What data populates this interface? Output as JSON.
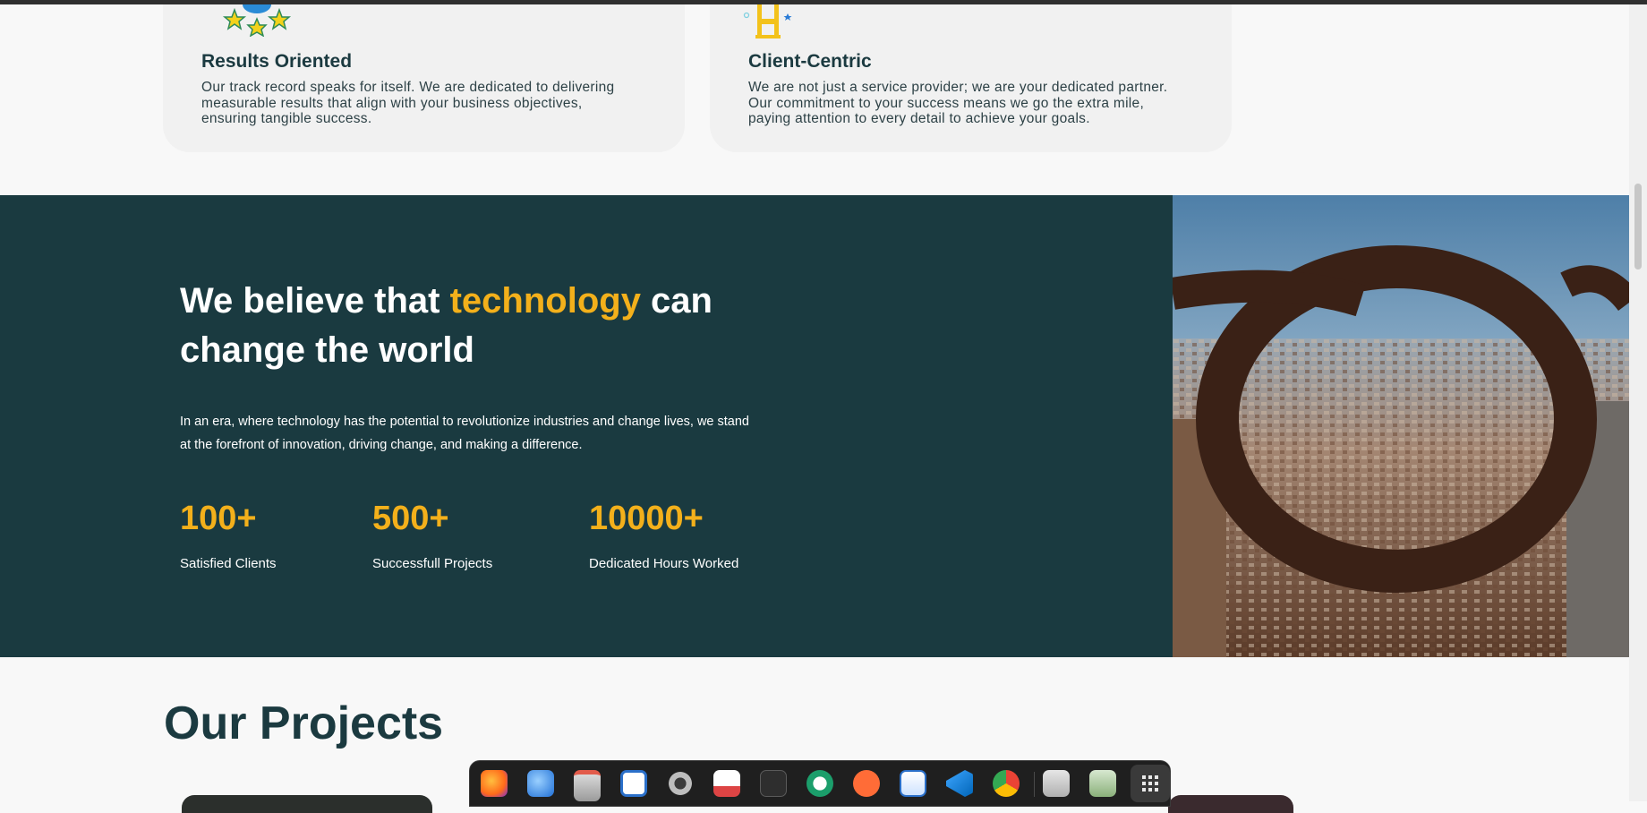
{
  "features": [
    {
      "title": "Results Oriented",
      "icon": "medal-stars-icon",
      "lines": [
        "Our track record speaks for itself. We are dedicated to delivering",
        "measurable results that align with your business objectives,",
        "ensuring tangible success."
      ]
    },
    {
      "title": "Client-Centric",
      "icon": "trophy-icon",
      "lines": [
        "We are not just a service provider; we are your dedicated partner.",
        "Our commitment to your success means we go the extra mile,",
        "paying attention to every detail to achieve your goals."
      ]
    }
  ],
  "hero": {
    "headline_pre": "We believe that ",
    "headline_accent": "technology",
    "headline_post": " can change the world",
    "description": "In an era, where technology has the potential to revolutionize industries and change lives, we stand at the forefront of innovation, driving change, and making a difference.",
    "accent_color": "#f3b01b",
    "background_color": "#1a3a40"
  },
  "stats": [
    {
      "value": "100+",
      "label": "Satisfied Clients"
    },
    {
      "value": "500+",
      "label": "Successfull Projects"
    },
    {
      "value": "10000+",
      "label": "Dedicated Hours Worked"
    }
  ],
  "projects": {
    "title": "Our Projects"
  },
  "dock": {
    "items": [
      "firefox-icon",
      "thunderbird-icon",
      "files-icon",
      "writer-icon",
      "settings-icon",
      "document-viewer-icon",
      "terminal-icon",
      "remote-desktop-icon",
      "postman-icon",
      "text-editor-icon",
      "vscode-icon",
      "chrome-icon",
      "image-viewer-icon",
      "trash-icon",
      "app-grid-icon"
    ]
  }
}
